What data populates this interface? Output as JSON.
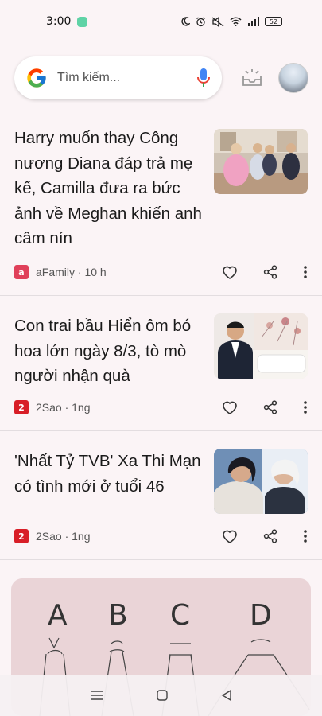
{
  "status": {
    "time": "3:00",
    "battery": "52"
  },
  "search": {
    "placeholder": "Tìm kiếm..."
  },
  "articles": [
    {
      "title": "Harry muốn thay Công nương Diana đáp trả mẹ kế, Camilla đưa ra bức ảnh về Meghan khiến anh câm nín",
      "source": "aFamily · 10 h",
      "source_icon": "a"
    },
    {
      "title": "Con trai bầu Hiển ôm bó hoa lớn ngày 8/3, tò mò người nhận quà",
      "source": "2Sao · 1ng",
      "source_icon": "2"
    },
    {
      "title": "'Nhất Tỷ TVB' Xa Thi Mạn có tình mới ở tuổi 46",
      "source": "2Sao · 1ng",
      "source_icon": "2"
    }
  ],
  "promo": {
    "letters": [
      "A",
      "B",
      "C",
      "D"
    ]
  },
  "colors": {
    "background": "#fbf4f6",
    "afamily": "#e0405a",
    "sao": "#d81e27",
    "mic_blue": "#4285f4"
  }
}
